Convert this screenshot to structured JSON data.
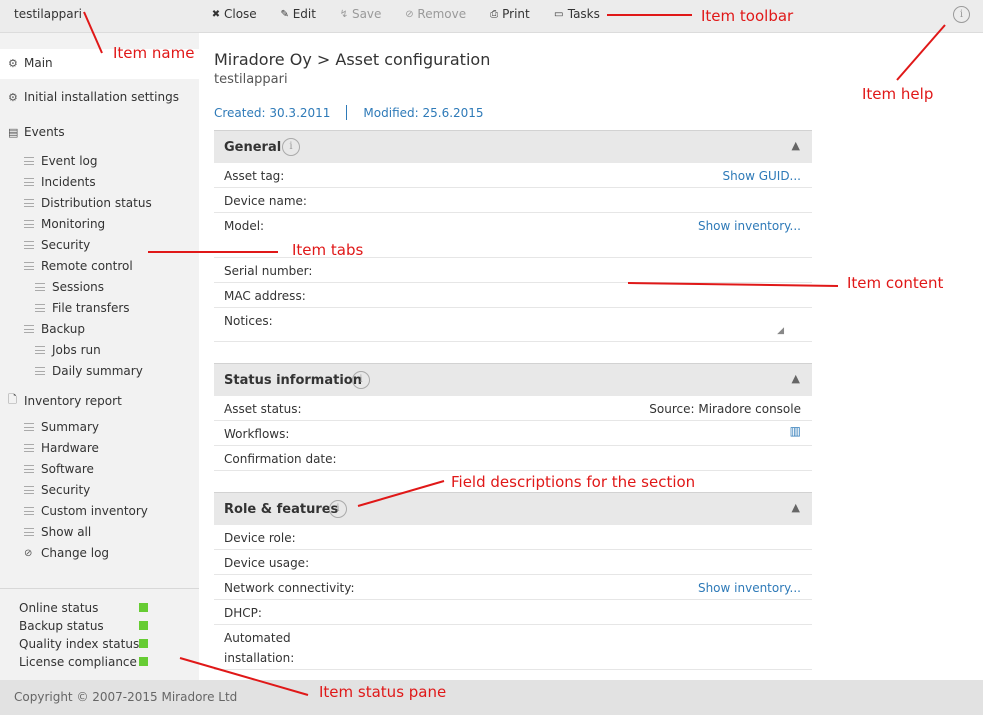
{
  "item_name": "testilappari",
  "toolbar": {
    "close": "Close",
    "edit": "Edit",
    "save": "Save",
    "remove": "Remove",
    "print": "Print",
    "tasks": "Tasks"
  },
  "help_icon": "i",
  "sidebar": {
    "main": "Main",
    "initial_installation": "Initial installation settings",
    "events": "Events",
    "event_items": [
      "Event log",
      "Incidents",
      "Distribution status",
      "Monitoring",
      "Security",
      "Remote control"
    ],
    "remote_sub": [
      "Sessions",
      "File transfers"
    ],
    "backup": "Backup",
    "backup_sub": [
      "Jobs run",
      "Daily summary"
    ],
    "inventory_report": "Inventory report",
    "inventory_items": [
      "Summary",
      "Hardware",
      "Software",
      "Security",
      "Custom inventory",
      "Show all"
    ],
    "change_log": "Change log"
  },
  "status_pane": {
    "items": [
      "Online status",
      "Backup status",
      "Quality index status",
      "License compliance"
    ],
    "color": "#66cc33"
  },
  "footer": "Copyright © 2007-2015 Miradore Ltd",
  "header": {
    "title": "Miradore Oy > Asset configuration",
    "subtitle": "testilappari",
    "created": "Created: 30.3.2011",
    "modified": "Modified: 25.6.2015"
  },
  "general": {
    "title": "General",
    "asset_tag": "Asset tag:",
    "show_guid": "Show GUID...",
    "device_name": "Device name:",
    "model": "Model:",
    "show_inventory": "Show inventory...",
    "serial": "Serial number:",
    "mac": "MAC address:",
    "notices": "Notices:"
  },
  "status_info": {
    "title": "Status information",
    "asset_status": "Asset status:",
    "source": "Source: Miradore console",
    "workflows": "Workflows:",
    "confirmation": "Confirmation date:"
  },
  "role": {
    "title": "Role & features",
    "device_role": "Device role:",
    "device_usage": "Device usage:",
    "network": "Network connectivity:",
    "show_inventory": "Show inventory...",
    "dhcp": "DHCP:",
    "automated_1": "Automated",
    "automated_2": "installation:"
  },
  "annotations": {
    "item_name": "Item name",
    "item_toolbar": "Item toolbar",
    "item_help": "Item help",
    "item_tabs": "Item tabs",
    "item_content": "Item content",
    "field_descriptions": "Field descriptions for the section",
    "item_status_pane": "Item status pane",
    "color": "#e01818"
  }
}
